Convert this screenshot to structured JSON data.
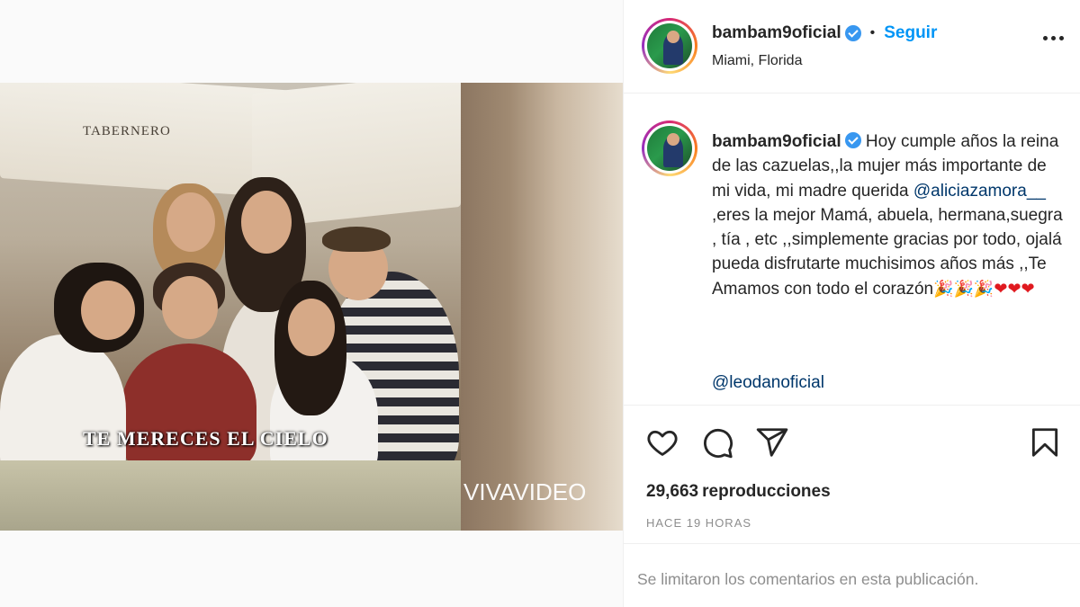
{
  "post": {
    "username": "bambam9oficial",
    "follow_label": "Seguir",
    "separator": "•",
    "location": "Miami, Florida"
  },
  "video": {
    "restaurant_sign": "TABERNERO",
    "overlay_text": "TE MERECES EL CIELO",
    "watermark": "VIVAVIDEO"
  },
  "caption": {
    "username": "bambam9oficial",
    "text_before_mention": "Hoy cumple años la reina de las cazuelas,,la mujer más importante de mi vida, mi madre querida ",
    "mention": "@aliciazamora__",
    "text_after_mention": " ,eres la mejor Mamá, abuela, hermana,suegra , tía , etc ,,simplemente gracias por todo, ojalá pueda disfrutarte muchisimos años más ,,Te Amamos con todo el corazón",
    "emojis": [
      "🎉",
      "🎉",
      "🎉",
      "❤",
      "❤",
      "❤"
    ],
    "second_mention": "@leodanoficial"
  },
  "stats": {
    "views_count": "29,663",
    "views_label": "reproducciones",
    "time_ago": "HACE 19 HORAS"
  },
  "footer": {
    "comments_limited": "Se limitaron los comentarios en esta publicación."
  },
  "icons": {
    "like": "heart-outline-icon",
    "comment": "comment-bubble-icon",
    "share": "paper-plane-icon",
    "save": "bookmark-icon",
    "more": "more-dots-icon",
    "verified": "verified-badge-icon"
  },
  "colors": {
    "link_blue": "#0095f6",
    "mention_blue": "#00376b",
    "muted": "#8e8e8e",
    "verified": "#3897f0"
  }
}
